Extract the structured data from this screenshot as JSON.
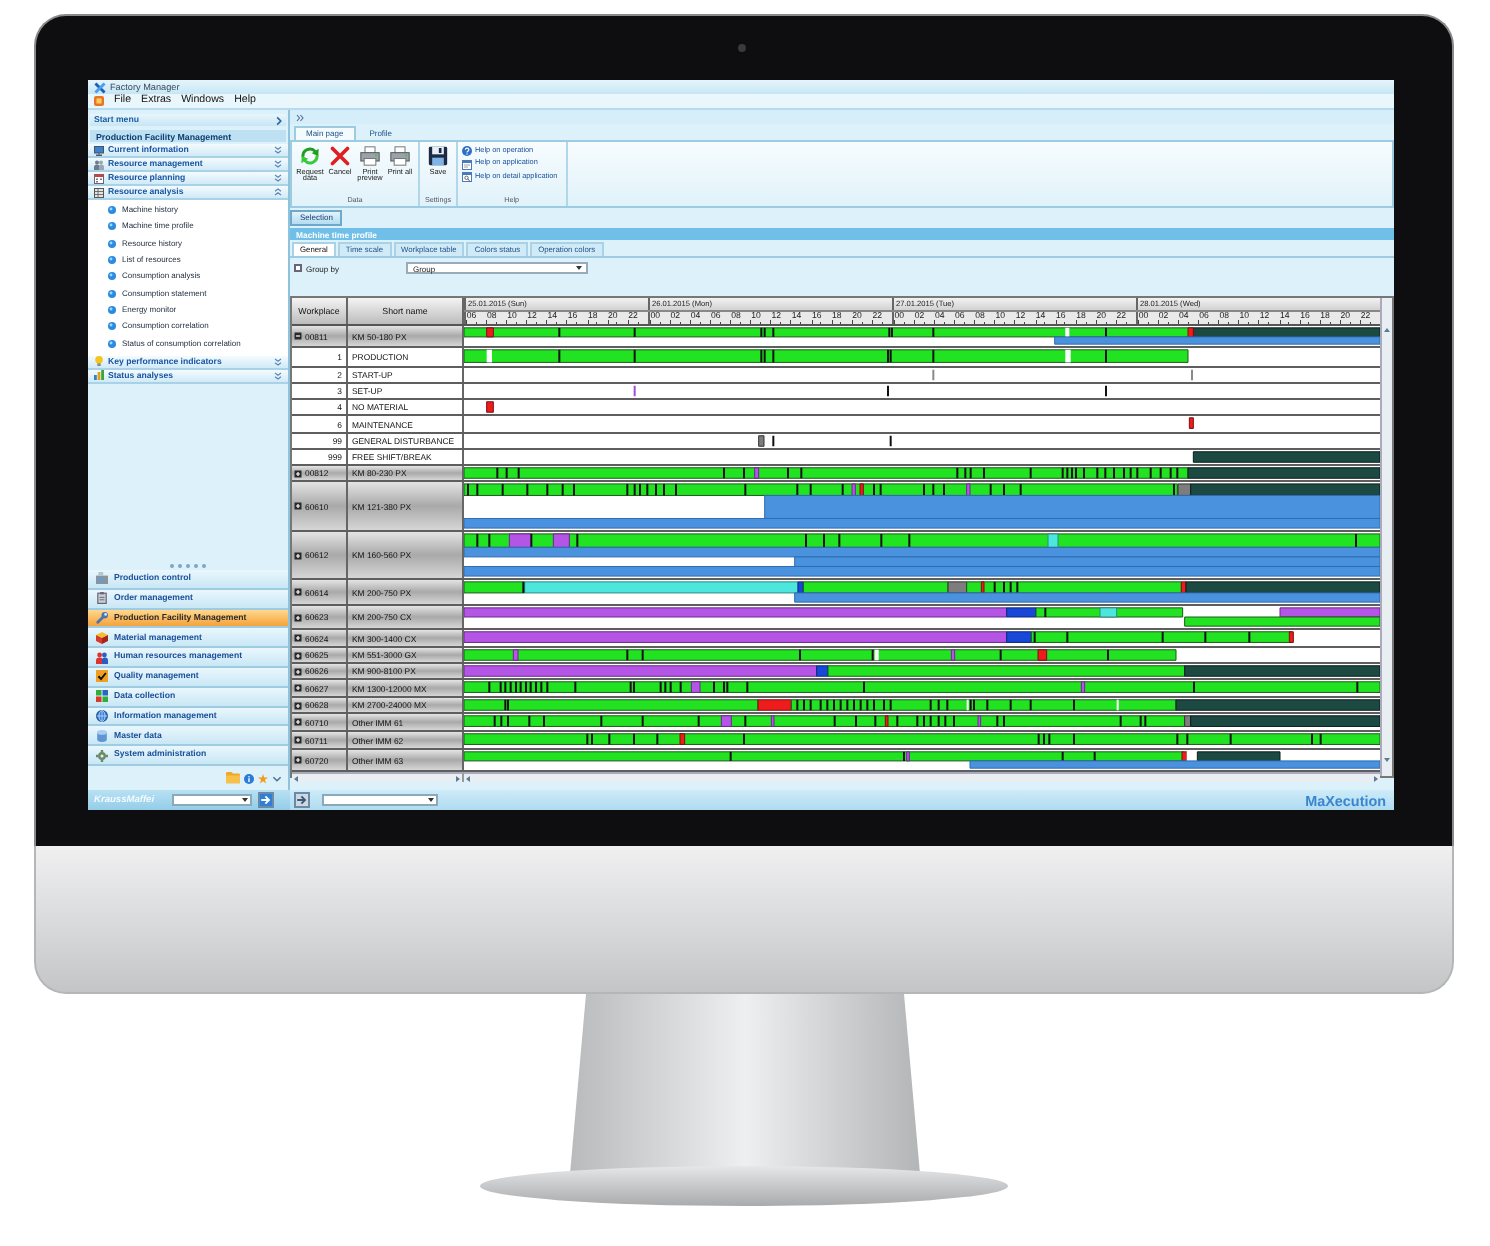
{
  "window": {
    "title": "Factory Manager"
  },
  "menu": [
    "File",
    "Extras",
    "Windows",
    "Help"
  ],
  "sidebar": {
    "start_menu": "Start menu",
    "module_title": "Production Facility Management",
    "sections": [
      {
        "label": "Current information",
        "expanded": false
      },
      {
        "label": "Resource management",
        "expanded": false
      },
      {
        "label": "Resource planning",
        "expanded": false
      },
      {
        "label": "Resource analysis",
        "expanded": true,
        "items": [
          "Machine history",
          "Machine time profile",
          "Resource history",
          "List of resources",
          "Consumption analysis",
          "Consumption statement",
          "Energy monitor",
          "Consumption correlation",
          "Status of consumption correlation"
        ]
      },
      {
        "label": "Key performance indicators",
        "expanded": false
      },
      {
        "label": "Status analyses",
        "expanded": false
      }
    ],
    "modules": [
      {
        "label": "Production control",
        "selected": false
      },
      {
        "label": "Order management",
        "selected": false
      },
      {
        "label": "Production Facility Management",
        "selected": true
      },
      {
        "label": "Material management",
        "selected": false
      },
      {
        "label": "Human resources management",
        "selected": false
      },
      {
        "label": "Quality management",
        "selected": false
      },
      {
        "label": "Data collection",
        "selected": false
      },
      {
        "label": "Information management",
        "selected": false
      },
      {
        "label": "Master data",
        "selected": false
      },
      {
        "label": "System administration",
        "selected": false
      }
    ]
  },
  "ribbon": {
    "tabs": [
      {
        "label": "Main page",
        "selected": true
      },
      {
        "label": "Profile",
        "selected": false
      }
    ],
    "groups": [
      {
        "label": "Data",
        "buttons": [
          "Request data",
          "Cancel",
          "Print preview",
          "Print all"
        ]
      },
      {
        "label": "Settings",
        "buttons": [
          "Save"
        ]
      },
      {
        "label": "Help",
        "links": [
          "Help on operation",
          "Help on application",
          "Help on detail application"
        ]
      }
    ]
  },
  "selection_tab": {
    "label": "Selection",
    "selected": true
  },
  "panel": {
    "title": "Machine time profile",
    "tabs": [
      {
        "label": "General",
        "selected": true
      },
      {
        "label": "Time scale",
        "selected": false
      },
      {
        "label": "Workplace table",
        "selected": false
      },
      {
        "label": "Colors status",
        "selected": false
      },
      {
        "label": "Operation colors",
        "selected": false
      }
    ],
    "group_by": {
      "label": "Group by",
      "checked": false
    },
    "group_select": {
      "value": "Group"
    }
  },
  "table": {
    "columns": [
      "Workplace",
      "Short name"
    ],
    "rows": [
      {
        "kind": "machine",
        "workplace": "00811",
        "short_name": "KM 50-180 PX",
        "expanded": true
      },
      {
        "kind": "status",
        "code": "1",
        "short_name": "PRODUCTION"
      },
      {
        "kind": "status",
        "code": "2",
        "short_name": "START-UP"
      },
      {
        "kind": "status",
        "code": "3",
        "short_name": "SET-UP"
      },
      {
        "kind": "status",
        "code": "4",
        "short_name": "NO MATERIAL"
      },
      {
        "kind": "status",
        "code": "6",
        "short_name": "MAINTENANCE"
      },
      {
        "kind": "status",
        "code": "99",
        "short_name": "GENERAL DISTURBANCE"
      },
      {
        "kind": "status",
        "code": "999",
        "short_name": "FREE SHIFT/BREAK"
      },
      {
        "kind": "machine",
        "workplace": "00812",
        "short_name": "KM 80-230 PX",
        "expanded": false
      },
      {
        "kind": "machine",
        "workplace": "60610",
        "short_name": "KM 121-380 PX",
        "expanded": false
      },
      {
        "kind": "machine",
        "workplace": "60612",
        "short_name": "KM 160-560 PX",
        "expanded": false
      },
      {
        "kind": "machine",
        "workplace": "60614",
        "short_name": "KM 200-750 PX",
        "expanded": false
      },
      {
        "kind": "machine",
        "workplace": "60623",
        "short_name": "KM 200-750 CX",
        "expanded": false
      },
      {
        "kind": "machine",
        "workplace": "60624",
        "short_name": "KM 300-1400 CX",
        "expanded": false
      },
      {
        "kind": "machine",
        "workplace": "60625",
        "short_name": "KM 551-3000 GX",
        "expanded": false
      },
      {
        "kind": "machine",
        "workplace": "60626",
        "short_name": "KM 900-8100 PX",
        "expanded": false
      },
      {
        "kind": "machine",
        "workplace": "60627",
        "short_name": "KM 1300-12000 MX",
        "expanded": false
      },
      {
        "kind": "machine",
        "workplace": "60628",
        "short_name": "KM 2700-24000 MX",
        "expanded": false
      },
      {
        "kind": "machine",
        "workplace": "60710",
        "short_name": "Other IMM 61",
        "expanded": false
      },
      {
        "kind": "machine",
        "workplace": "60711",
        "short_name": "Other IMM 62",
        "expanded": false
      },
      {
        "kind": "machine",
        "workplace": "60720",
        "short_name": "Other IMM 63",
        "expanded": false
      }
    ]
  },
  "time_scale": {
    "days": [
      {
        "date": "25.01.2015 (Sun)",
        "hours": [
          "06",
          "08",
          "10",
          "12",
          "14",
          "16",
          "18",
          "20",
          "22"
        ]
      },
      {
        "date": "26.01.2015 (Mon)",
        "hours": [
          "00",
          "02",
          "04",
          "06",
          "08",
          "10",
          "12",
          "14",
          "16",
          "18",
          "20",
          "22"
        ]
      },
      {
        "date": "27.01.2015 (Tue)",
        "hours": [
          "00",
          "02",
          "04",
          "06",
          "08",
          "10",
          "12",
          "14",
          "16",
          "18",
          "20",
          "22"
        ]
      },
      {
        "date": "28.01.2015 (Wed)",
        "hours": [
          "00",
          "02",
          "04",
          "06",
          "08",
          "10",
          "12",
          "14",
          "16",
          "18",
          "20",
          "22"
        ]
      }
    ]
  },
  "footer": {
    "brand": "KraussMaffei",
    "product": "MaXecution"
  }
}
